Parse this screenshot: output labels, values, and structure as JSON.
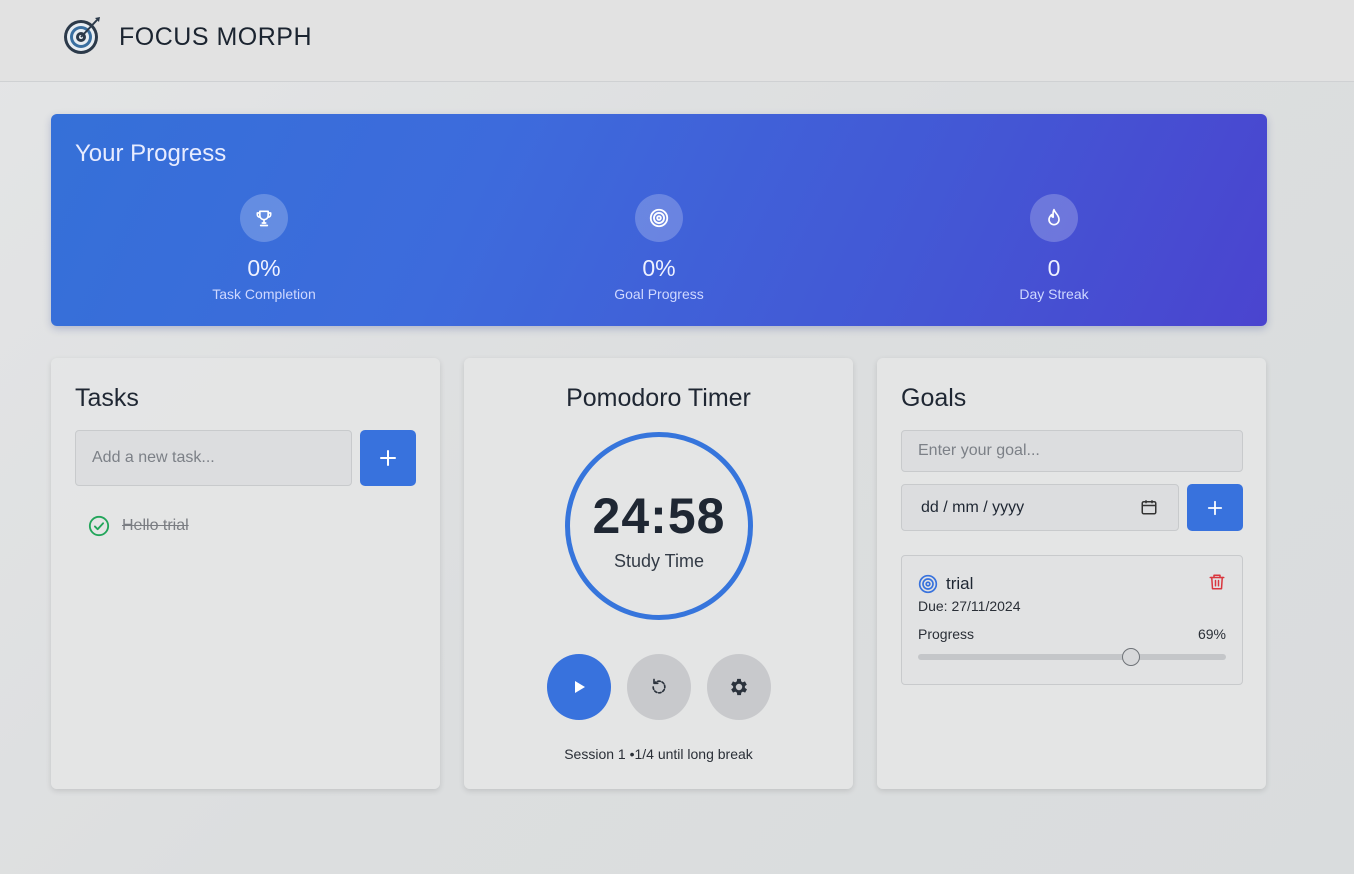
{
  "header": {
    "brand": "FOCUS MORPH",
    "logo_icon": "target-dart-icon"
  },
  "progress": {
    "title": "Your Progress",
    "stats": [
      {
        "icon": "trophy-icon",
        "value": "0%",
        "label": "Task Completion"
      },
      {
        "icon": "target-icon",
        "value": "0%",
        "label": "Goal Progress"
      },
      {
        "icon": "flame-icon",
        "value": "0",
        "label": "Day Streak"
      }
    ]
  },
  "tasks": {
    "title": "Tasks",
    "input_placeholder": "Add a new task...",
    "add_icon": "plus-icon",
    "items": [
      {
        "text": "Hello trial",
        "completed": true
      }
    ]
  },
  "timer": {
    "title": "Pomodoro Timer",
    "time": "24:58",
    "mode": "Study Time",
    "session": "Session 1 •1/4 until long break",
    "controls": [
      "play-icon",
      "reset-icon",
      "settings-icon"
    ]
  },
  "goals": {
    "title": "Goals",
    "input_placeholder": "Enter your goal...",
    "date_placeholder": "dd / mm / yyyy",
    "items": [
      {
        "name": "trial",
        "due": "Due: 27/11/2024",
        "progress_label": "Progress",
        "progress_text": "69%",
        "progress": 0.69
      }
    ]
  },
  "colors": {
    "accent": "#3872dd",
    "success": "#22a55a",
    "danger": "#d9363e",
    "banner_start": "#3570d8",
    "banner_end": "#4a44cf"
  }
}
